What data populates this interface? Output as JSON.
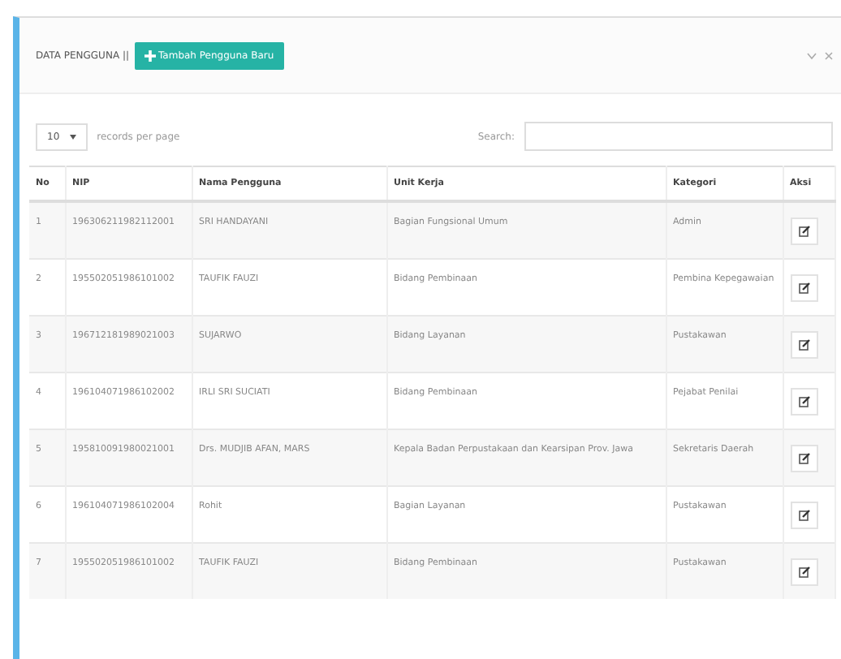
{
  "panel": {
    "title": "DATA PENGGUNA ||",
    "add_button": "Tambah Pengguna Baru"
  },
  "controls": {
    "page_size": "10",
    "page_size_label": "records per page",
    "search_label": "Search:"
  },
  "table": {
    "columns": [
      "No",
      "NIP",
      "Nama Pengguna",
      "Unit Kerja",
      "Kategori",
      "Aksi"
    ],
    "rows": [
      {
        "no": "1",
        "nip": "196306211982112001",
        "nama": "SRI HANDAYANI",
        "unit": "Bagian Fungsional Umum",
        "kategori": "Admin"
      },
      {
        "no": "2",
        "nip": "195502051986101002",
        "nama": "TAUFIK FAUZI",
        "unit": "Bidang Pembinaan",
        "kategori": "Pembina Kepegawaian"
      },
      {
        "no": "3",
        "nip": "196712181989021003",
        "nama": "SUJARWO",
        "unit": "Bidang Layanan",
        "kategori": "Pustakawan"
      },
      {
        "no": "4",
        "nip": "196104071986102002",
        "nama": "IRLI SRI SUCIATI",
        "unit": "Bidang Pembinaan",
        "kategori": "Pejabat Penilai"
      },
      {
        "no": "5",
        "nip": "195810091980021001",
        "nama": "Drs. MUDJIB AFAN, MARS",
        "unit": "Kepala Badan Perpustakaan dan Kearsipan Prov. Jawa",
        "kategori": "Sekretaris Daerah"
      },
      {
        "no": "6",
        "nip": "196104071986102004",
        "nama": "Rohit",
        "unit": "Bagian Layanan",
        "kategori": "Pustakawan"
      },
      {
        "no": "7",
        "nip": "195502051986101002",
        "nama": "TAUFIK FAUZI",
        "unit": "Bidang Pembinaan",
        "kategori": "Pustakawan"
      }
    ]
  }
}
